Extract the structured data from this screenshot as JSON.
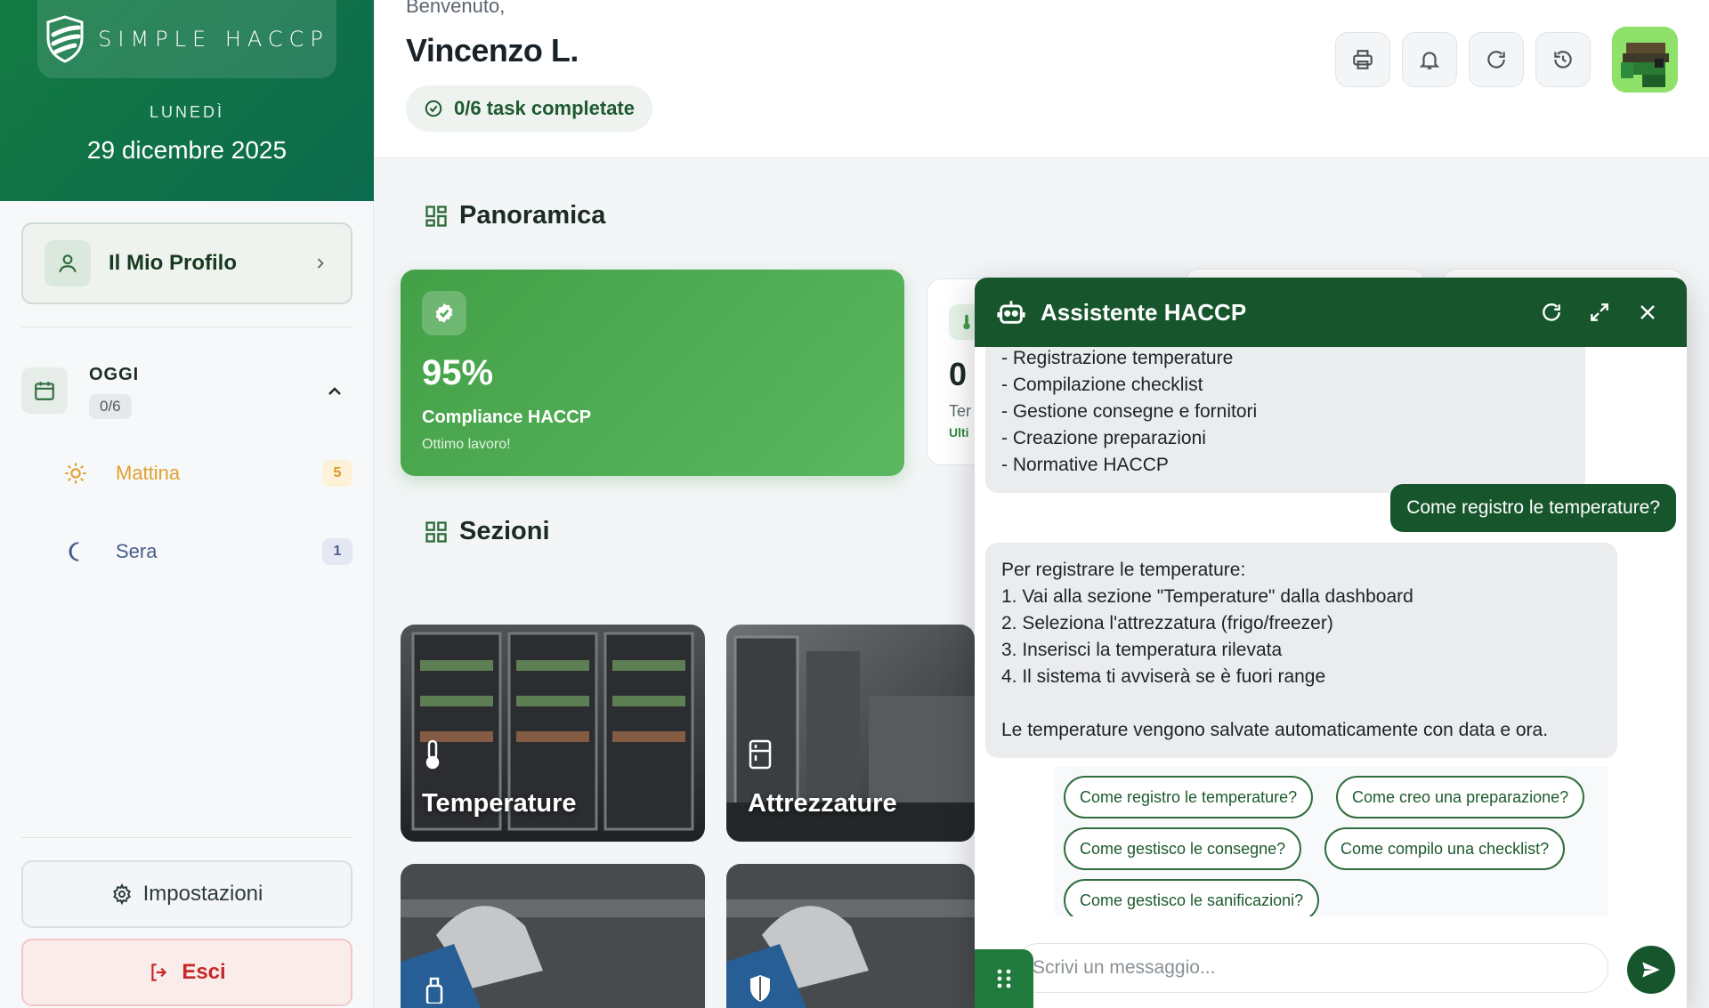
{
  "brand": {
    "logo_text": "SIMPLE HACCP",
    "day": "LUNEDÌ",
    "date": "29 dicembre 2025",
    "gradient_colors": [
      "#137a43",
      "#0c6a4d"
    ]
  },
  "sidebar": {
    "profile_label": "Il Mio Profilo",
    "today": {
      "label": "OGGI",
      "count": "0/6"
    },
    "shifts": [
      {
        "name": "Mattina",
        "count": "5",
        "color": "#e0a030"
      },
      {
        "name": "Sera",
        "count": "1",
        "color": "#4a5d8a"
      }
    ],
    "settings_label": "Impostazioni",
    "logout_label": "Esci"
  },
  "header": {
    "welcome": "Benvenuto,",
    "user_name": "Vincenzo L.",
    "task_status": "0/6 task completate",
    "actions": [
      "printer-icon",
      "bell-icon",
      "refresh-icon",
      "history-icon"
    ]
  },
  "overview": {
    "title": "Panoramica",
    "compliance": {
      "value": "95%",
      "label": "Compliance HACCP",
      "sub": "Ottimo lavoro!"
    },
    "stat_partial": {
      "value": "0",
      "label": "Ter",
      "sub": "Ulti"
    }
  },
  "sections": {
    "title": "Sezioni",
    "tiles": [
      {
        "name": "Temperature",
        "icon": "thermometer-icon"
      },
      {
        "name": "Attrezzature",
        "icon": "fridge-icon"
      },
      {
        "name": "",
        "icon": "spray-icon"
      },
      {
        "name": "",
        "icon": "shield-icon"
      }
    ]
  },
  "chat": {
    "title": "Assistente HACCP",
    "messages": [
      {
        "from": "bot",
        "text": "- Registrazione temperature\n- Compilazione checklist\n- Gestione consegne e fornitori\n- Creazione preparazioni\n- Normative HACCP"
      },
      {
        "from": "user",
        "text": "Come registro le temperature?"
      },
      {
        "from": "bot",
        "text": "Per registrare le temperature:\n1. Vai alla sezione \"Temperature\" dalla dashboard\n2. Seleziona l'attrezzatura (frigo/freezer)\n3. Inserisci la temperatura rilevata\n4. Il sistema ti avviserà se è fuori range\n\nLe temperature vengono salvate automaticamente con data e ora."
      }
    ],
    "suggestions": [
      "Come registro le temperature?",
      "Come creo una preparazione?",
      "Come gestisco le consegne?",
      "Come compilo una checklist?",
      "Come gestisco le sanificazioni?"
    ],
    "input_placeholder": "Scrivi un messaggio...",
    "accent": "#17562c"
  }
}
